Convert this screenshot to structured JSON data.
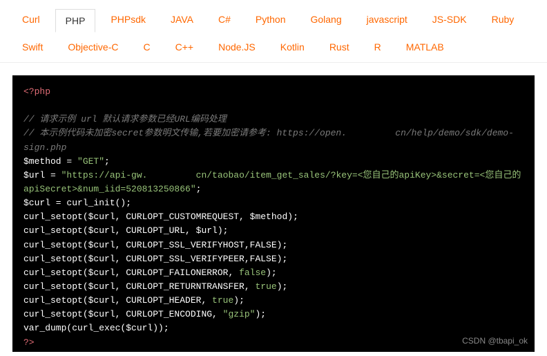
{
  "tabs": {
    "row": [
      "Curl",
      "PHP",
      "PHPsdk",
      "JAVA",
      "C#",
      "Python",
      "Golang",
      "javascript",
      "JS-SDK",
      "Ruby",
      "Swift",
      "Objective-C",
      "C",
      "C++",
      "Node.JS",
      "Kotlin",
      "Rust",
      "R",
      "MATLAB"
    ],
    "active": "PHP"
  },
  "code": {
    "open_tag": "<?php",
    "comment1": "//  请求示例 url 默认请求参数已经URL编码处理",
    "comment2_a": "//  本示例代码未加密secret参数明文传输,若要加密请参考: https://open.",
    "comment2_b": "cn/help/demo/sdk/demo-sign.php",
    "l_method_a": "$method = ",
    "l_method_s": "\"GET\"",
    "l_method_e": ";",
    "l_url_a": "$url = ",
    "l_url_s1": "\"https://api-gw.",
    "l_url_s2": "cn/taobao/item_get_sales/?key=<您自己的apiKey>&secret=<您自己的apiSecret>&num_iid=520813250866\"",
    "l_url_e": ";",
    "l_curl_init": "$curl = curl_init();",
    "l1": "curl_setopt($curl, CURLOPT_CUSTOMREQUEST, $method);",
    "l2": "curl_setopt($curl, CURLOPT_URL, $url);",
    "l3a": "curl_setopt($curl, CURLOPT_SSL_VERIFYHOST,",
    "l3b": "FALSE",
    "l3c": ");",
    "l4a": "curl_setopt($curl, CURLOPT_SSL_VERIFYPEER,",
    "l4b": "FALSE",
    "l4c": ");",
    "l5a": "curl_setopt($curl, CURLOPT_FAILONERROR, ",
    "l5b": "false",
    "l5c": ");",
    "l6a": "curl_setopt($curl, CURLOPT_RETURNTRANSFER, ",
    "l6b": "true",
    "l6c": ");",
    "l7a": "curl_setopt($curl, CURLOPT_HEADER, ",
    "l7b": "true",
    "l7c": ");",
    "l8a": "curl_setopt($curl, CURLOPT_ENCODING, ",
    "l8b": "\"gzip\"",
    "l8c": ");",
    "l9": "var_dump(curl_exec($curl));",
    "close_tag": "?>"
  },
  "watermark": "CSDN @tbapi_ok"
}
